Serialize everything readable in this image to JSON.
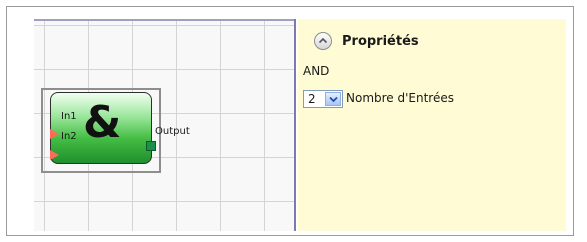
{
  "block": {
    "symbol": "&",
    "inputs": [
      "In1",
      "In2"
    ],
    "output": "Output"
  },
  "properties": {
    "title": "Propriétés",
    "block_type": "AND",
    "inputs_count_value": "2",
    "inputs_count_label": "Nombre d'Entrées"
  },
  "icons": {
    "collapse": "chevron-up-icon",
    "dropdown": "chevron-down-icon"
  },
  "colors": {
    "panel_bg": "#fffbd4",
    "block_green": "#44bd44",
    "input_pin": "#ff6a5a",
    "output_pin": "#1c8f4a"
  }
}
